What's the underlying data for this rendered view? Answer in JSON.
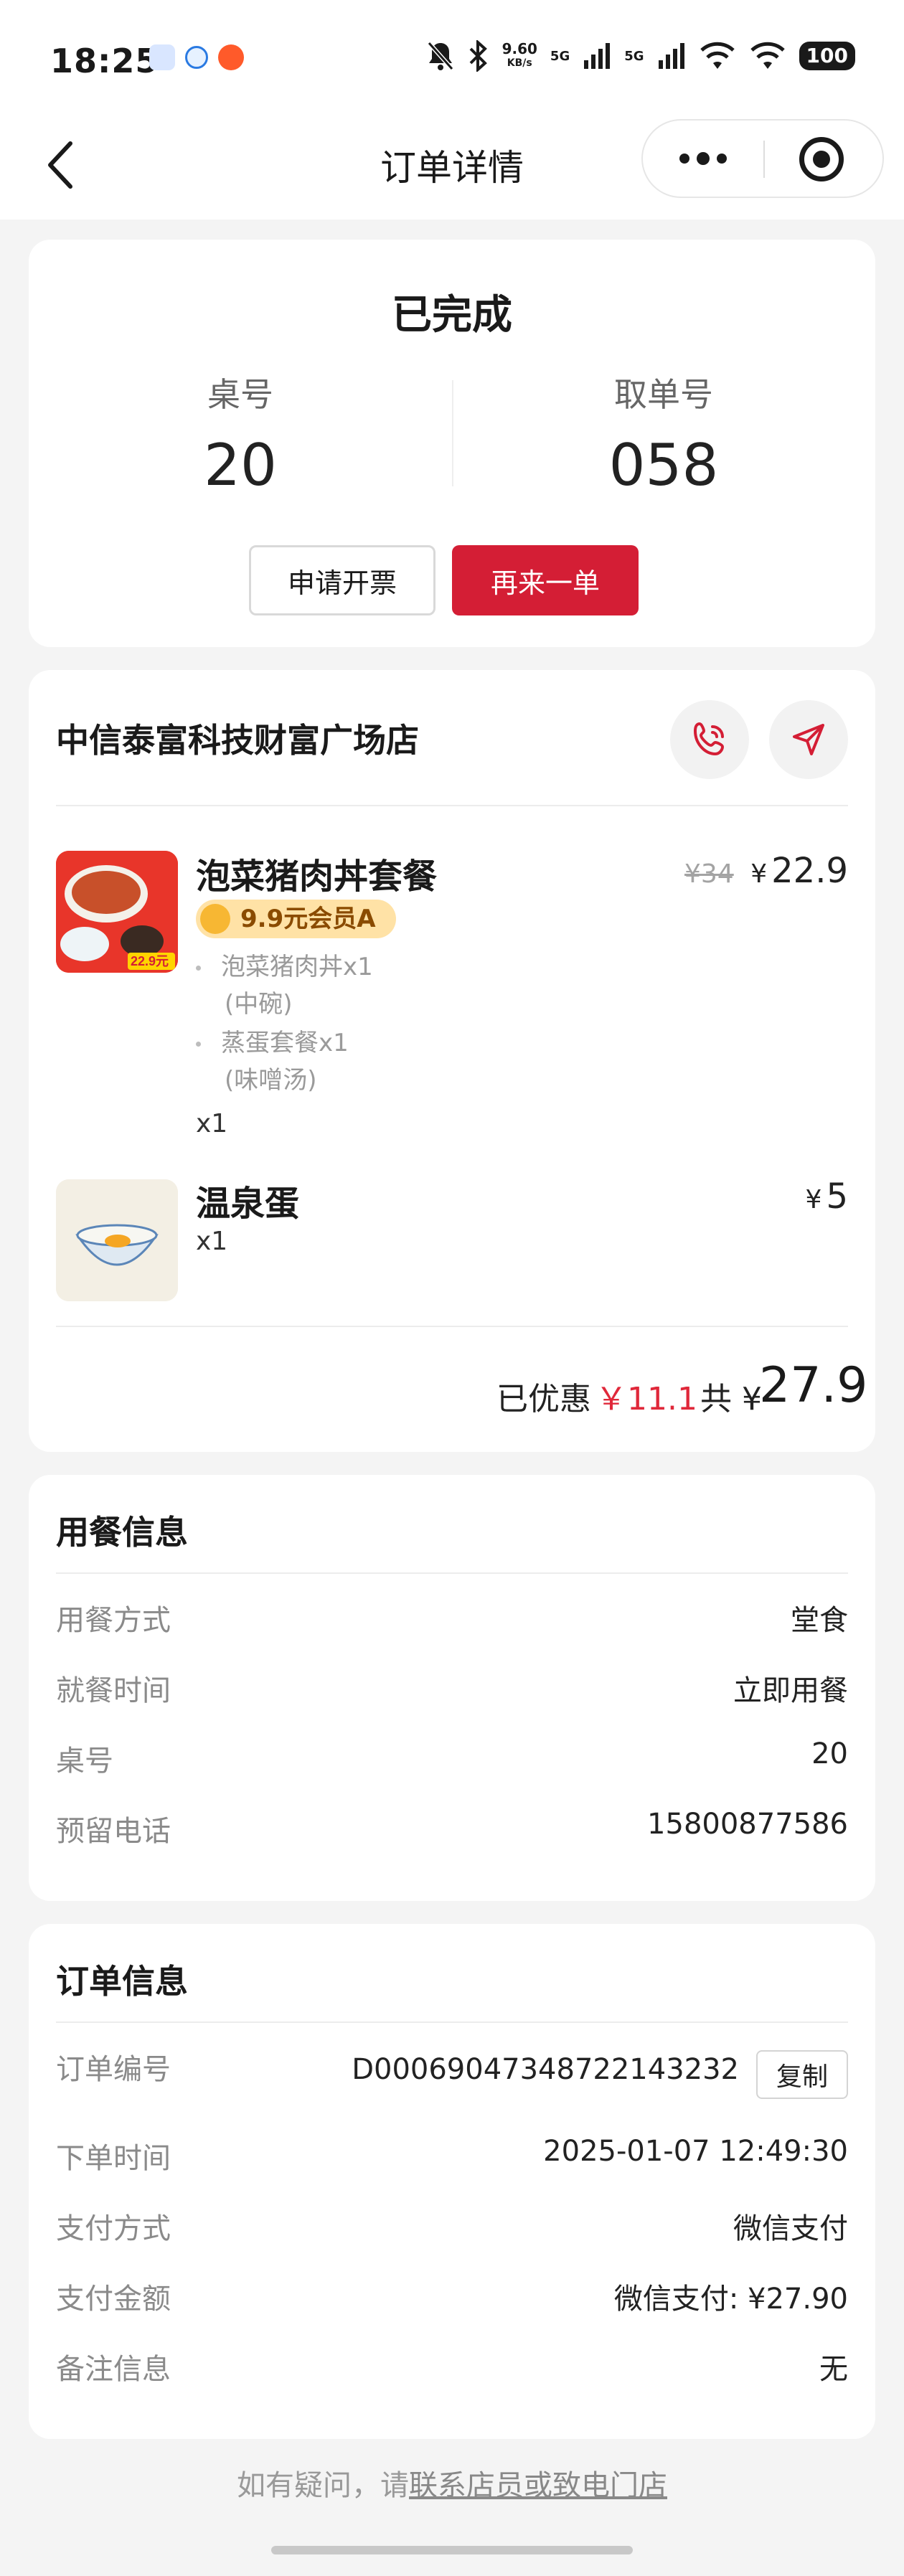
{
  "status_bar": {
    "time": "18:25",
    "speed_value": "9.60",
    "speed_unit": "KB/s",
    "network_1": "5G",
    "network_2": "5G",
    "battery": "100"
  },
  "nav": {
    "title": "订单详情"
  },
  "order_status": {
    "title": "已完成",
    "table_label": "桌号",
    "table_value": "20",
    "pickup_label": "取单号",
    "pickup_value": "058",
    "invoice_button": "申请开票",
    "reorder_button": "再来一单"
  },
  "store": {
    "name": "中信泰富科技财富广场店",
    "items": [
      {
        "name": "泡菜猪肉丼套餐",
        "badge": "9.9元会员A",
        "sub_items": [
          "泡菜猪肉丼x1",
          "(中碗)",
          "蒸蛋套餐x1",
          "(味噌汤)"
        ],
        "qty": "x1",
        "original_price": "¥34",
        "currency": "¥",
        "price": "22.9",
        "thumb_text": "22.9元"
      },
      {
        "name": "温泉蛋",
        "qty": "x1",
        "currency": "¥",
        "price": "5"
      }
    ],
    "discount_label": "已优惠",
    "discount_value": "￥11.1",
    "total_label": "共 ¥",
    "total_value": "27.9"
  },
  "dining_info": {
    "title": "用餐信息",
    "rows": [
      {
        "label": "用餐方式",
        "value": "堂食"
      },
      {
        "label": "就餐时间",
        "value": "立即用餐"
      },
      {
        "label": "桌号",
        "value": "20"
      },
      {
        "label": "预留电话",
        "value": "15800877586"
      }
    ]
  },
  "order_info": {
    "title": "订单信息",
    "copy_button": "复制",
    "rows": [
      {
        "label": "订单编号",
        "value": "D00069047348722143232"
      },
      {
        "label": "下单时间",
        "value": "2025-01-07 12:49:30"
      },
      {
        "label": "支付方式",
        "value": "微信支付"
      },
      {
        "label": "支付金额",
        "value": "微信支付: ¥27.90"
      },
      {
        "label": "备注信息",
        "value": "无"
      }
    ]
  },
  "footer": {
    "prefix": "如有疑问，请",
    "link": "联系店员或致电门店"
  },
  "colors": {
    "accent_red": "#d41e35",
    "discount_red": "#e0283a",
    "badge_bg": "#ffe2a6"
  },
  "icons": [
    "back-icon",
    "more-icon",
    "close-mini-program-icon",
    "phone-icon",
    "navigation-icon",
    "crown-icon"
  ]
}
